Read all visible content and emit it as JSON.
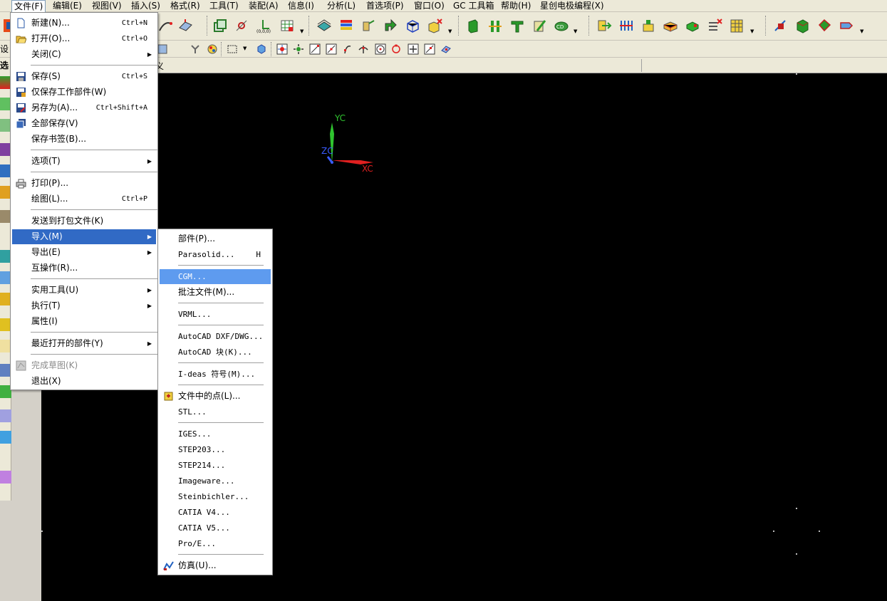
{
  "menubar": {
    "items": [
      {
        "label": "文件(F)",
        "active": true
      },
      {
        "label": "编辑(E)"
      },
      {
        "label": "视图(V)"
      },
      {
        "label": "插入(S)"
      },
      {
        "label": "格式(R)"
      },
      {
        "label": "工具(T)"
      },
      {
        "label": "装配(A)"
      },
      {
        "label": "信息(I)"
      },
      {
        "label": "分析(L)"
      },
      {
        "label": "首选项(P)"
      },
      {
        "label": "窗口(O)"
      },
      {
        "label": "GC 工具箱"
      },
      {
        "label": "帮助(H)"
      },
      {
        "label": "星创电极编程(X)"
      }
    ]
  },
  "left_fragments": {
    "toolbar_text": "设",
    "panel_text": "选"
  },
  "tabstrip": {
    "fragment": "义"
  },
  "file_menu": {
    "items": [
      {
        "label": "新建(N)...",
        "shortcut": "Ctrl+N",
        "icon": "new-file-icon"
      },
      {
        "label": "打开(O)...",
        "shortcut": "Ctrl+O",
        "icon": "open-folder-icon"
      },
      {
        "label": "关闭(C)",
        "submenu": true
      },
      {
        "label": "保存(S)",
        "shortcut": "Ctrl+S",
        "icon": "save-icon"
      },
      {
        "label": "仅保存工作部件(W)",
        "icon": "save-work-part-icon"
      },
      {
        "label": "另存为(A)...",
        "shortcut": "Ctrl+Shift+A",
        "icon": "save-as-icon"
      },
      {
        "label": "全部保存(V)",
        "icon": "save-all-icon"
      },
      {
        "label": "保存书签(B)..."
      },
      {
        "label": "选项(T)",
        "submenu": true
      },
      {
        "label": "打印(P)...",
        "icon": "print-icon"
      },
      {
        "label": "绘图(L)...",
        "shortcut": "Ctrl+P"
      },
      {
        "label": "发送到打包文件(K)"
      },
      {
        "label": "导入(M)",
        "submenu": true,
        "highlighted": true
      },
      {
        "label": "导出(E)",
        "submenu": true
      },
      {
        "label": "互操作(R)..."
      },
      {
        "label": "实用工具(U)",
        "submenu": true
      },
      {
        "label": "执行(T)",
        "submenu": true
      },
      {
        "label": "属性(I)"
      },
      {
        "label": "最近打开的部件(Y)",
        "submenu": true
      },
      {
        "label": "完成草图(K)",
        "disabled": true,
        "icon": "finish-sketch-icon"
      },
      {
        "label": "退出(X)"
      }
    ]
  },
  "import_menu": {
    "items": [
      {
        "label": "部件(P)..."
      },
      {
        "label": "Parasolid...",
        "shortcut": "H"
      },
      {
        "label": "CGM...",
        "highlighted": true
      },
      {
        "label": "批注文件(M)..."
      },
      {
        "label": "VRML..."
      },
      {
        "label": "AutoCAD DXF/DWG..."
      },
      {
        "label": "AutoCAD 块(K)..."
      },
      {
        "label": "I-deas 符号(M)..."
      },
      {
        "label": "文件中的点(L)...",
        "icon": "points-from-file-icon"
      },
      {
        "label": "STL..."
      },
      {
        "label": "IGES..."
      },
      {
        "label": "STEP203..."
      },
      {
        "label": "STEP214..."
      },
      {
        "label": "Imageware..."
      },
      {
        "label": "Steinbichler..."
      },
      {
        "label": "CATIA V4..."
      },
      {
        "label": "CATIA V5..."
      },
      {
        "label": "Pro/E..."
      },
      {
        "label": "仿真(U)...",
        "icon": "simulation-icon"
      }
    ]
  },
  "triad": {
    "y_label": "YC",
    "z_label": "ZC",
    "x_label": "XC",
    "colors": {
      "y": "#2fc42f",
      "z": "#3a5cff",
      "x": "#e02020"
    }
  },
  "colors": {
    "menu_highlight": "#316ac5",
    "submenu_highlight": "#5e9bef",
    "viewport_bg": "#000000",
    "chrome_bg": "#ece9d8"
  }
}
